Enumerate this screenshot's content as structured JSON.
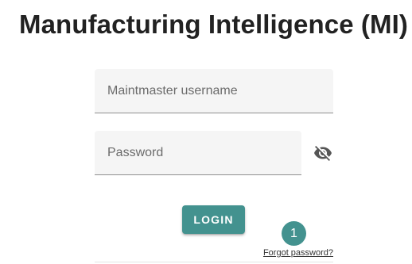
{
  "page": {
    "title": "Manufacturing Intelligence (MI)"
  },
  "form": {
    "username": {
      "placeholder": "Maintmaster username",
      "value": ""
    },
    "password": {
      "placeholder": "Password",
      "value": "",
      "visibility_icon": "eye-off-icon"
    },
    "login_label": "LOGIN",
    "forgot_password_label": "Forgot password?",
    "notification_badge": "1"
  },
  "colors": {
    "accent": "#43928f",
    "field_background": "#f5f5f5",
    "title_text": "#222222"
  }
}
